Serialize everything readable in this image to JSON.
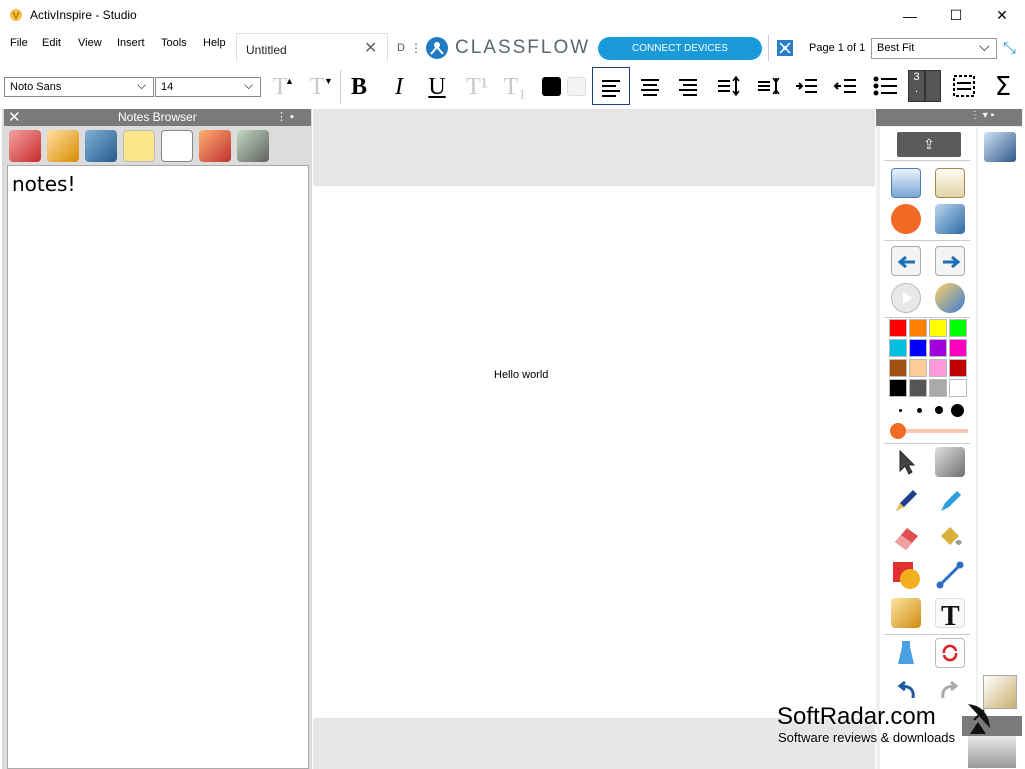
{
  "window": {
    "title": "ActivInspire - Studio",
    "minimize_glyph": "—",
    "maximize_glyph": "☐",
    "close_glyph": "✕"
  },
  "menu": {
    "items": [
      "File",
      "Edit",
      "View",
      "Insert",
      "Tools",
      "Help"
    ]
  },
  "tabs": {
    "active_label": "Untitled",
    "close_glyph": "✕",
    "overflow_label": "D",
    "more_glyph": "⋮"
  },
  "classflow": {
    "logo_text": "CLASSFLOW",
    "connect_label": "CONNECT DEVICES",
    "page_indicator": "Page 1 of 1",
    "zoom_value": "Best Fit",
    "dropdown_glyph": "⌵",
    "expand_glyph": "⤡"
  },
  "format": {
    "font_family": "Noto Sans",
    "font_size": "14",
    "dropdown_glyph": "⌵",
    "bold": "B",
    "italic": "I",
    "underline": "U",
    "grow_text": "T",
    "shrink_text": "T",
    "superscript": "T¹",
    "subscript": "T₁",
    "bullets": "≡",
    "sigma": "Σ",
    "text_color": "#000000",
    "highlight_color": "#f3f3f3",
    "number_box_top": "3",
    "number_box_bottom": "."
  },
  "notes_browser": {
    "title": "Notes Browser",
    "close_glyph": "✕",
    "pin_glyph": "⋮ ▪",
    "content": "notes!"
  },
  "canvas": {
    "text": "Hello world"
  },
  "toolbox": {
    "header_glyph": "⋮ ▾ ▪",
    "export_glyph": "⇪",
    "palette": [
      [
        "#ff0000",
        "#ff8000",
        "#ffff00",
        "#00ff00"
      ],
      [
        "#00c0e0",
        "#0000ff",
        "#a000e0",
        "#ff00c0"
      ],
      [
        "#a05010",
        "#ffcc99",
        "#ff99dd",
        "#c00000"
      ],
      [
        "#000000",
        "#555555",
        "#aaaaaa",
        "#ffffff"
      ]
    ],
    "accent": "#f26a23"
  },
  "watermark": {
    "main": "SoftRadar.com",
    "sub": "Software reviews & downloads"
  }
}
